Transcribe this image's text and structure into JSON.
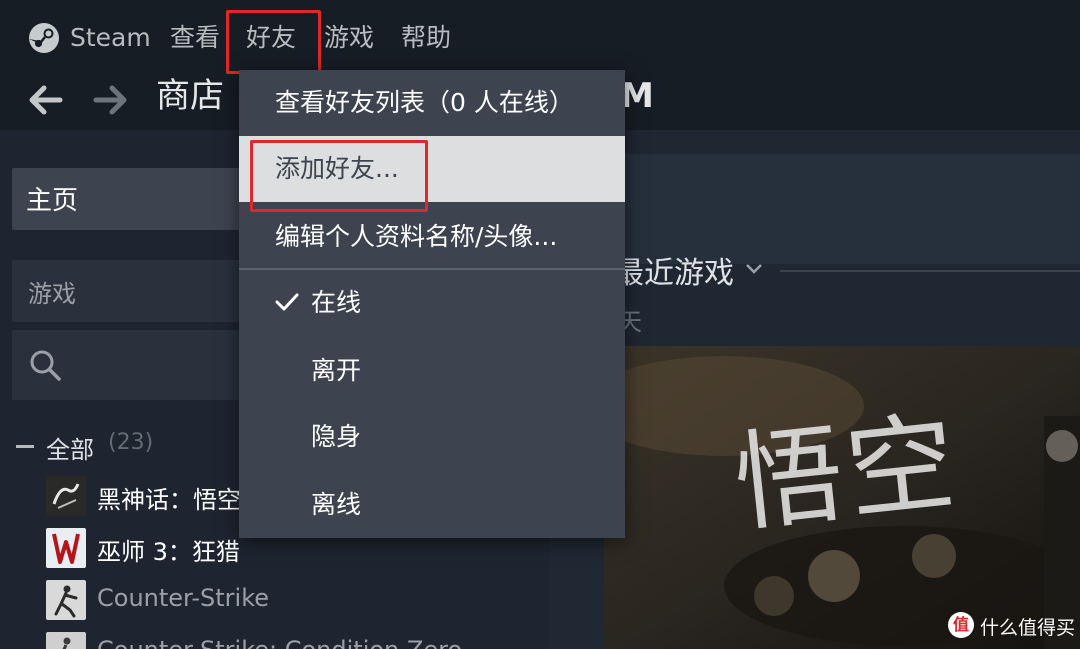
{
  "menubar": {
    "items": [
      "Steam",
      "查看",
      "好友",
      "游戏",
      "帮助"
    ]
  },
  "nav": {
    "title": "商店",
    "partial": "M"
  },
  "sidebar": {
    "home": "主页",
    "games_filter": "游戏",
    "all_label": "全部",
    "all_count": "(23)",
    "games": [
      {
        "name": "黑神话：悟空",
        "thumb_color": "#2a2a28"
      },
      {
        "name": "巫师 3：狂猎",
        "thumb_color": "#e9eef2"
      },
      {
        "name": "Counter-Strike",
        "thumb_color": "#d9d9d9"
      },
      {
        "name": "Counter-Strike: Condition Zero",
        "thumb_color": "#cfcfcf"
      }
    ]
  },
  "main": {
    "recent_title": "最近游戏",
    "recent_sub": "天",
    "hero_title": "悟空"
  },
  "friends_menu": {
    "items": [
      "查看好友列表（0 人在线）",
      "添加好友...",
      "编辑个人资料名称/头像...",
      "在线",
      "离开",
      "隐身",
      "离线"
    ],
    "checked_item": "在线"
  },
  "watermark": {
    "badge": "值",
    "text": "什么值得买"
  },
  "colors": {
    "highlight": "#e0272b",
    "menu_bg": "#3d4450",
    "hover_bg": "#dcdedf"
  }
}
